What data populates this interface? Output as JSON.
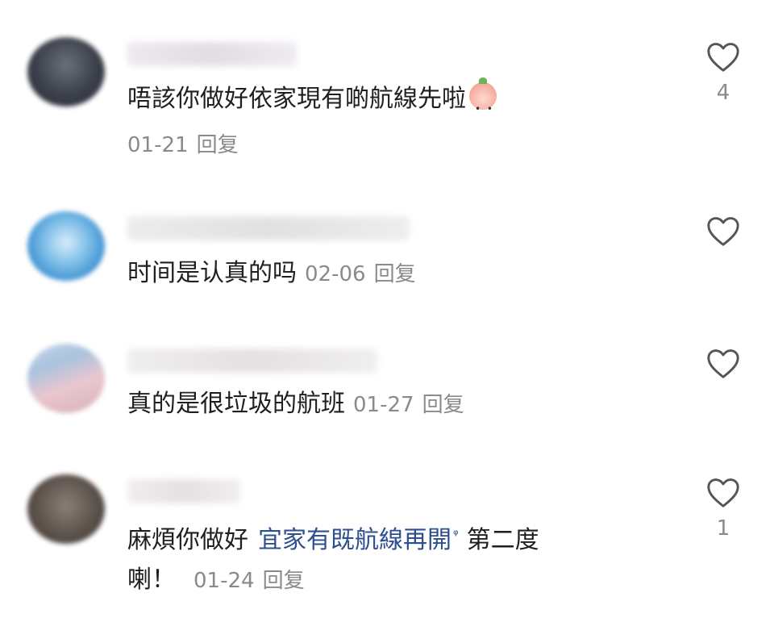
{
  "comments": [
    {
      "text": "唔該你做好依家現有啲航線先啦",
      "date": "01-21",
      "reply": "回复",
      "likes": "4",
      "emoji": "baby-face-emoji"
    },
    {
      "text": "时间是认真的吗",
      "date": "02-06",
      "reply": "回复",
      "likes": ""
    },
    {
      "text": "真的是很垃圾的航班",
      "date": "01-27",
      "reply": "回复",
      "likes": ""
    },
    {
      "text": "麻煩你做好",
      "link": "宜家有既航線再開",
      "text_after": "第二度",
      "text_line2": "喇！",
      "date": "01-24",
      "reply": "回复",
      "likes": "1"
    }
  ],
  "icons": {
    "like": "heart-outline-icon",
    "search": "search-icon"
  },
  "colors": {
    "text": "#1f1f1f",
    "meta": "#8a8a8a",
    "link": "#2d4f8e"
  }
}
